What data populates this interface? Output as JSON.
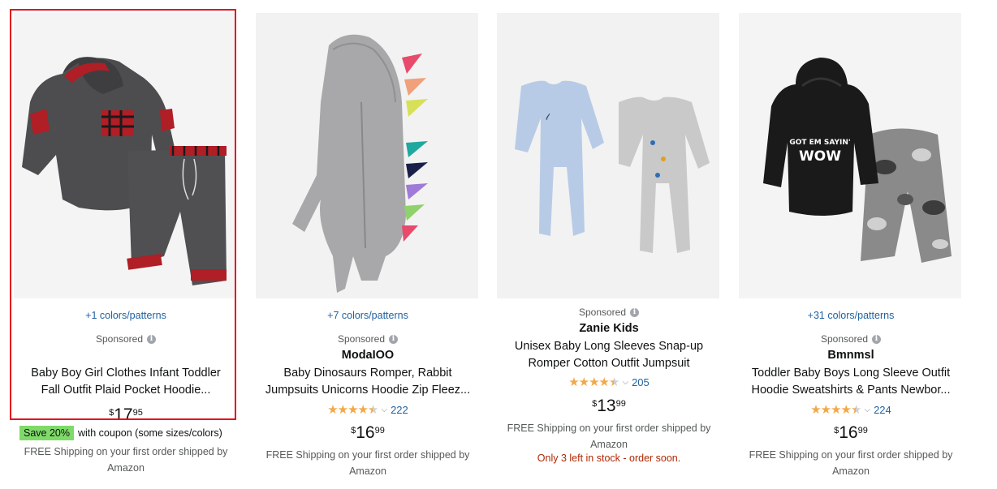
{
  "top_fragment": "",
  "products": [
    {
      "colors_link": "+1 colors/patterns",
      "sponsored": "Sponsored",
      "brand": "",
      "title_line1": "Baby Boy Girl Clothes Infant Toddler",
      "title_line2": "Fall Outfit Plaid Pocket Hoodie...",
      "price_symbol": "$",
      "price_whole": "17",
      "price_fraction": "95",
      "coupon_badge": "Save 20%",
      "coupon_text": "with coupon (some sizes/colors)",
      "shipping_line1": "FREE Shipping on your first order shipped by",
      "shipping_line2": "Amazon"
    },
    {
      "colors_link": "+7 colors/patterns",
      "sponsored": "Sponsored",
      "brand": "ModaIOO",
      "title_line1": "Baby Dinosaurs Romper, Rabbit",
      "title_line2": "Jumpsuits Unicorns Hoodie Zip Fleez...",
      "rating": 4.5,
      "review_count": "222",
      "price_symbol": "$",
      "price_whole": "16",
      "price_fraction": "99",
      "shipping_line1": "FREE Shipping on your first order shipped by",
      "shipping_line2": "Amazon"
    },
    {
      "sponsored": "Sponsored",
      "brand": "Zanie Kids",
      "title_line1": "Unisex Baby Long Sleeves Snap-up",
      "title_line2": "Romper Cotton Outfit Jumpsuit",
      "rating": 4.5,
      "review_count": "205",
      "price_symbol": "$",
      "price_whole": "13",
      "price_fraction": "99",
      "shipping_line1": "FREE Shipping on your first order shipped by",
      "shipping_line2": "Amazon",
      "stock_note": "Only 3 left in stock - order soon."
    },
    {
      "colors_link": "+31 colors/patterns",
      "sponsored": "Sponsored",
      "brand": "Bmnmsl",
      "title_line1": "Toddler Baby Boys Long Sleeve Outfit",
      "title_line2": "Hoodie Sweatshirts & Pants Newbor...",
      "rating": 4.5,
      "review_count": "224",
      "price_symbol": "$",
      "price_whole": "16",
      "price_fraction": "99",
      "shipping_line1": "FREE Shipping on your first order shipped by",
      "shipping_line2": "Amazon"
    }
  ],
  "icons": {
    "info": "info-icon",
    "star": "star-icon",
    "chevron": "chevron-down-icon"
  },
  "colors": {
    "selection_border": "#e4101b",
    "link": "#2162a1",
    "star": "#f3a847",
    "coupon_badge": "#7fda69",
    "stock_warning": "#b12704"
  }
}
